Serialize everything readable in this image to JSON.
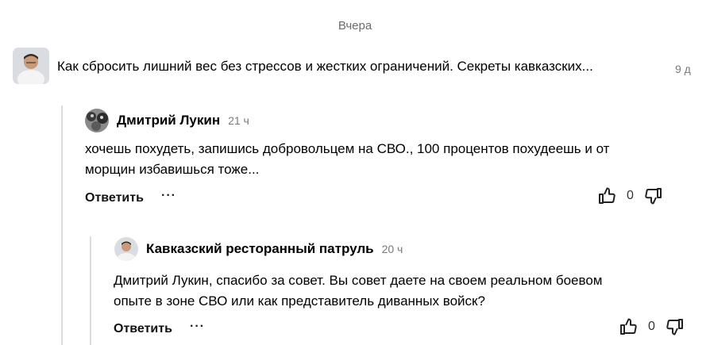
{
  "date_header": "Вчера",
  "notification": {
    "text": "Как сбросить лишний вес без стрессов и жестких ограничений. Секреты кавказских...",
    "time": "9 д"
  },
  "comments": [
    {
      "author": "Дмитрий Лукин",
      "time": "21 ч",
      "text_line1": "хочешь похудеть, запишись добровольцем на СВО., 100 процентов похудеешь и от",
      "text_line2": "морщин избавишься тоже...",
      "reply_label": "Ответить",
      "more_label": "···",
      "likes": "0"
    },
    {
      "author": "Кавказский ресторанный патруль",
      "time": "20 ч",
      "text_line1": "Дмитрий Лукин, спасибо за совет. Вы совет даете на  своем реальном боевом",
      "text_line2": "опыте в зоне СВО или как представитель диванных войск?",
      "reply_label": "Ответить",
      "more_label": "···",
      "likes": "0"
    }
  ]
}
